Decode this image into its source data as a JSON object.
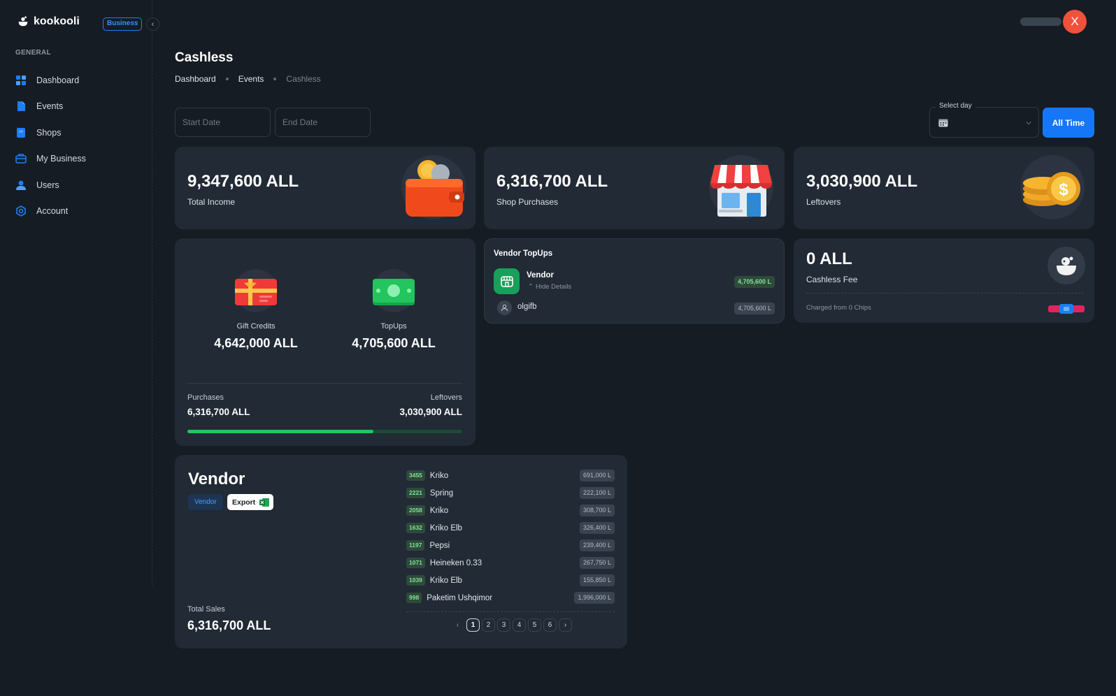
{
  "brand": {
    "name": "kookooli",
    "badge": "Business"
  },
  "sidebar": {
    "heading": "GENERAL",
    "items": [
      {
        "label": "Dashboard",
        "icon": "dashboard-icon"
      },
      {
        "label": "Events",
        "icon": "events-icon"
      },
      {
        "label": "Shops",
        "icon": "shops-icon"
      },
      {
        "label": "My Business",
        "icon": "business-icon"
      },
      {
        "label": "Users",
        "icon": "users-icon"
      },
      {
        "label": "Account",
        "icon": "account-icon"
      }
    ]
  },
  "user": {
    "avatar_initial": "X"
  },
  "header": {
    "title": "Cashless",
    "breadcrumb": [
      "Dashboard",
      "Events",
      "Cashless"
    ]
  },
  "filters": {
    "start_placeholder": "Start Date",
    "end_placeholder": "End Date",
    "select_day_label": "Select day",
    "all_time_label": "All Time"
  },
  "stats": {
    "total_income": {
      "value": "9,347,600 ALL",
      "label": "Total Income"
    },
    "shop_purchases": {
      "value": "6,316,700 ALL",
      "label": "Shop Purchases"
    },
    "leftovers": {
      "value": "3,030,900 ALL",
      "label": "Leftovers"
    }
  },
  "credits": {
    "gift": {
      "label": "Gift Credits",
      "value": "4,642,000 ALL"
    },
    "topups": {
      "label": "TopUps",
      "value": "4,705,600 ALL"
    },
    "purchases_label": "Purchases",
    "purchases_value": "6,316,700 ALL",
    "leftovers_label": "Leftovers",
    "leftovers_value": "3,030,900 ALL",
    "purchases_fraction": 0.676
  },
  "vendor_topups": {
    "title": "Vendor TopUps",
    "vendor_name": "Vendor",
    "hide_details": "Hide Details",
    "vendor_amount": "4,705,600 L",
    "user_name": "olgifb",
    "user_amount": "4,705,600 L"
  },
  "cashless_fee": {
    "value": "0 ALL",
    "label": "Cashless Fee",
    "charged": "Charged from 0 Chips"
  },
  "vendor_panel": {
    "title": "Vendor",
    "tag": "Vendor",
    "export_label": "Export",
    "total_label": "Total Sales",
    "total_value": "6,316,700 ALL",
    "rows": [
      {
        "code": "3455",
        "name": "Kriko",
        "amount": "691,000 L"
      },
      {
        "code": "2221",
        "name": "Spring",
        "amount": "222,100 L"
      },
      {
        "code": "2058",
        "name": "Kriko",
        "amount": "308,700 L"
      },
      {
        "code": "1632",
        "name": "Kriko Elb",
        "amount": "326,400 L"
      },
      {
        "code": "1197",
        "name": "Pepsi",
        "amount": "239,400 L"
      },
      {
        "code": "1071",
        "name": "Heineken 0.33",
        "amount": "267,750 L"
      },
      {
        "code": "1039",
        "name": "Kriko Elb",
        "amount": "155,850 L"
      },
      {
        "code": "998",
        "name": "Paketim Ushqimor",
        "amount": "1,996,000 L"
      }
    ],
    "pages": [
      "1",
      "2",
      "3",
      "4",
      "5",
      "6"
    ],
    "active_page": "1"
  }
}
